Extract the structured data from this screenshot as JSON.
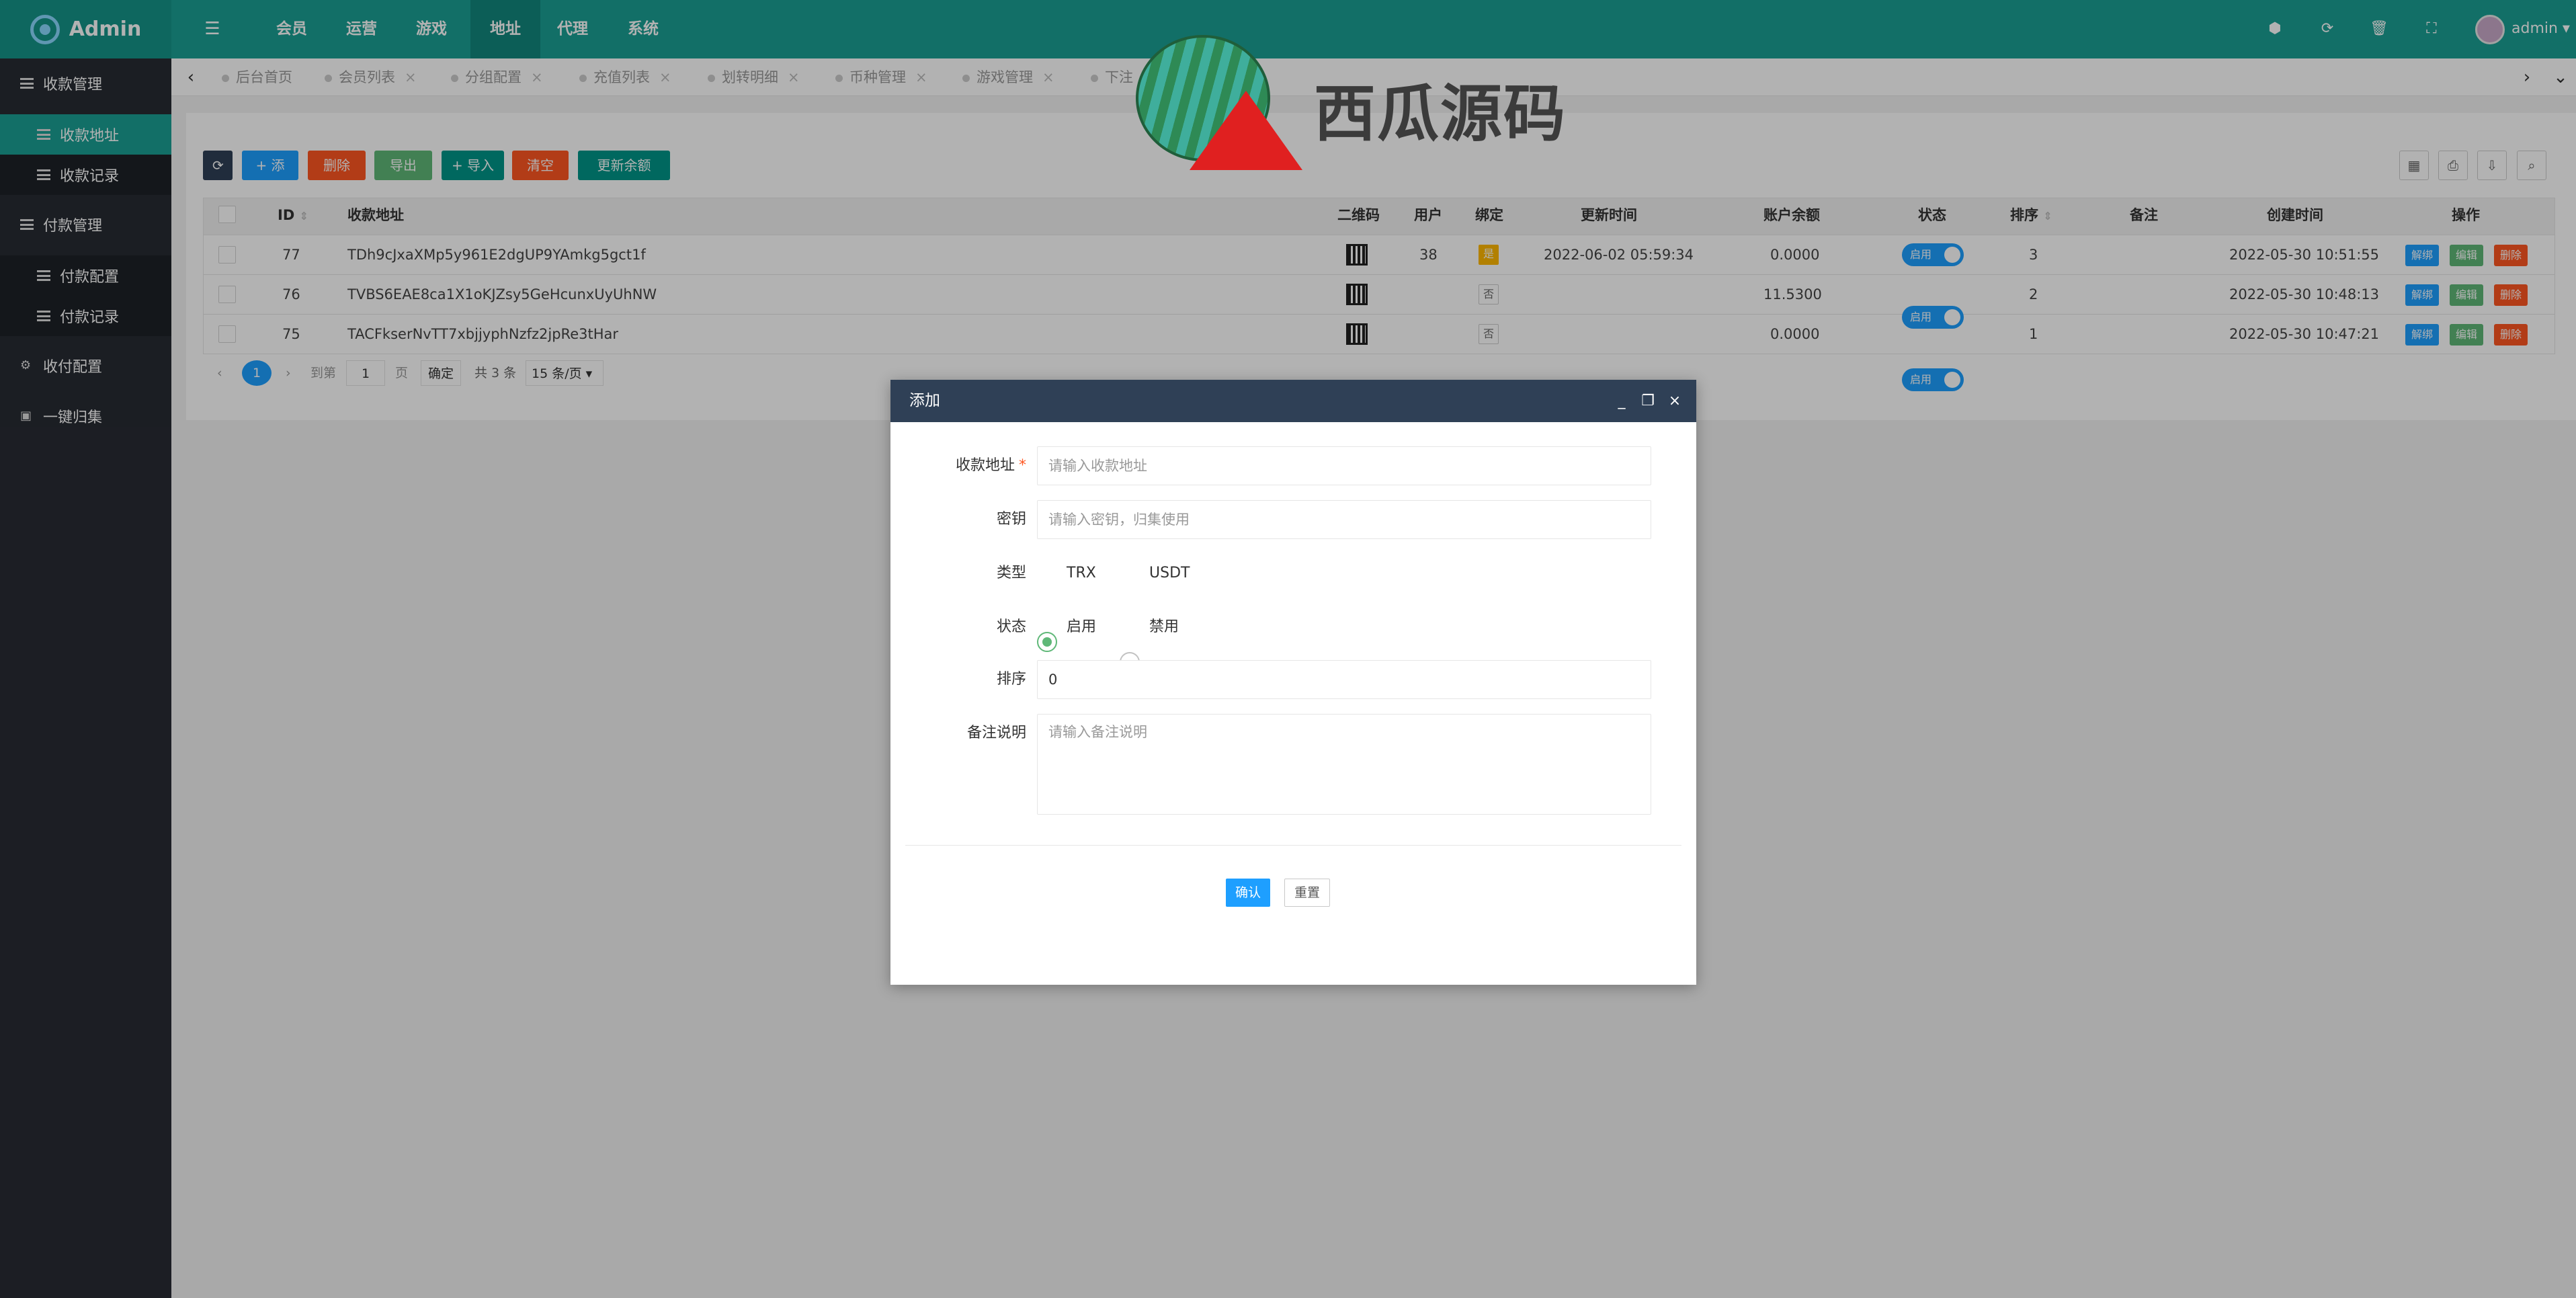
{
  "app": {
    "brand": "Admin",
    "username": "admin"
  },
  "topnav": [
    {
      "label": "会员"
    },
    {
      "label": "运营"
    },
    {
      "label": "游戏"
    },
    {
      "label": "地址"
    },
    {
      "label": "代理"
    },
    {
      "label": "系统"
    }
  ],
  "topnav_active": "地址",
  "sidebar": {
    "groups": [
      {
        "label": "收款管理",
        "children": [
          "收款地址",
          "收款记录"
        ]
      },
      {
        "label": "付款管理",
        "children": [
          "付款配置",
          "付款记录"
        ]
      },
      {
        "label": "收付配置"
      },
      {
        "label": "一键归集"
      }
    ],
    "active": "收款地址"
  },
  "tabs": [
    "后台首页",
    "会员列表",
    "分组配置",
    "充值列表",
    "划转明细",
    "币种管理",
    "游戏管理",
    "下注"
  ],
  "toolbar": {
    "refresh": "⟳",
    "add": "+ 添加",
    "delete": "删除",
    "export": "导出",
    "import": "+ 导入",
    "clear": "清空",
    "update_balance": "更新余额"
  },
  "table": {
    "columns": [
      "ID",
      "收款地址",
      "二维码",
      "用户",
      "绑定",
      "更新时间",
      "账户余额",
      "状态",
      "排序",
      "备注",
      "创建时间",
      "操作"
    ],
    "rows": [
      {
        "id": "77",
        "address": "TDh9cJxaXMp5y961E2dgUP9YAmkg5gct1f",
        "user": "38",
        "bound": "是",
        "updated": "2022-06-02 05:59:34",
        "balance": "0.0000",
        "status": "启用",
        "sort": "3",
        "note": "",
        "created": "2022-05-30 10:51:55"
      },
      {
        "id": "76",
        "address": "TVBS6EAE8ca1X1oKJZsy5GeHcunxUyUhNW",
        "user": "",
        "bound": "否",
        "updated": "",
        "balance": "11.5300",
        "status": "启用",
        "sort": "2",
        "note": "",
        "created": "2022-05-30 10:48:13"
      },
      {
        "id": "75",
        "address": "TACFkserNvTT7xbjjyphNzfz2jpRe3tHar",
        "user": "",
        "bound": "否",
        "updated": "",
        "balance": "0.0000",
        "status": "启用",
        "sort": "1",
        "note": "",
        "created": "2022-05-30 10:47:21"
      }
    ],
    "actions": [
      "解绑",
      "编辑",
      "删除"
    ]
  },
  "pagination": {
    "current": "1",
    "goto_label": "到第",
    "page_input": "1",
    "page_unit": "页",
    "confirm": "确定",
    "total": "共 3 条",
    "page_size": "15 条/页"
  },
  "modal": {
    "title": "添加",
    "fields": {
      "address_label": "收款地址",
      "address_placeholder": "请输入收款地址",
      "key_label": "密钥",
      "key_placeholder": "请输入密钥，归集使用",
      "type_label": "类型",
      "type_options": [
        "TRX",
        "USDT"
      ],
      "type_selected": "TRX",
      "status_label": "状态",
      "status_options": [
        "启用",
        "禁用"
      ],
      "status_selected": "启用",
      "sort_label": "排序",
      "sort_value": "0",
      "note_label": "备注说明",
      "note_placeholder": "请输入备注说明"
    },
    "confirm": "确认",
    "reset": "重置"
  },
  "watermark": {
    "text": "西瓜源码"
  },
  "colors": {
    "primary": "#1aa094",
    "sidebar": "#282b33",
    "modal_header": "#2f4056",
    "blue": "#1e9fff",
    "red": "#ff5722",
    "green": "#5fb878"
  }
}
